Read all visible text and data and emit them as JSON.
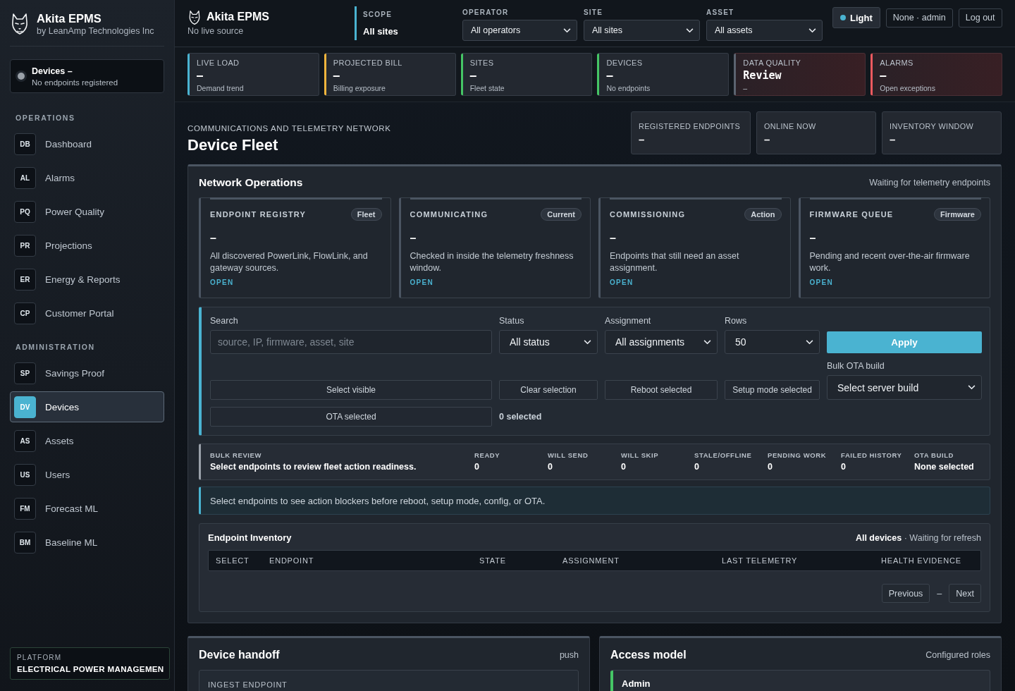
{
  "sidebar": {
    "brand": {
      "name": "Akita EPMS",
      "tagline": "by LeanAmp Technologies Inc"
    },
    "status": {
      "title": "Devices –",
      "detail": "No endpoints registered",
      "online": false
    },
    "sections": [
      {
        "title": "OPERATIONS",
        "items": [
          {
            "code": "DB",
            "label": "Dashboard",
            "selected": false
          },
          {
            "code": "AL",
            "label": "Alarms",
            "selected": false
          },
          {
            "code": "PQ",
            "label": "Power Quality",
            "selected": false
          },
          {
            "code": "PR",
            "label": "Projections",
            "selected": false
          },
          {
            "code": "ER",
            "label": "Energy & Reports",
            "selected": false
          },
          {
            "code": "CP",
            "label": "Customer Portal",
            "selected": false
          }
        ]
      },
      {
        "title": "ADMINISTRATION",
        "items": [
          {
            "code": "SP",
            "label": "Savings Proof",
            "selected": false
          },
          {
            "code": "DV",
            "label": "Devices",
            "selected": true
          },
          {
            "code": "AS",
            "label": "Assets",
            "selected": false
          },
          {
            "code": "US",
            "label": "Users",
            "selected": false
          },
          {
            "code": "FM",
            "label": "Forecast ML",
            "selected": false
          },
          {
            "code": "BM",
            "label": "Baseline ML",
            "selected": false
          }
        ]
      }
    ],
    "platform": {
      "label": "PLATFORM",
      "value": "ELECTRICAL POWER MANAGEMEN"
    }
  },
  "header": {
    "brand": "Akita EPMS",
    "source": "No live source",
    "scope": {
      "label": "SCOPE",
      "value": "All sites"
    },
    "filters": [
      {
        "label": "OPERATOR",
        "value": "All operators"
      },
      {
        "label": "SITE",
        "value": "All sites"
      },
      {
        "label": "ASSET",
        "value": "All assets"
      }
    ],
    "theme_button": "Light",
    "user_button": "None · admin",
    "logout_button": "Log out"
  },
  "kpis": [
    {
      "label": "LIVE LOAD",
      "value": "–",
      "caption": "Demand trend",
      "color": "#4ab3d1",
      "alert": false
    },
    {
      "label": "PROJECTED BILL",
      "value": "–",
      "caption": "Billing exposure",
      "color": "#f0b43c",
      "alert": false
    },
    {
      "label": "SITES",
      "value": "–",
      "caption": "Fleet state",
      "color": "#45c565",
      "alert": false
    },
    {
      "label": "DEVICES",
      "value": "–",
      "caption": "No endpoints",
      "color": "#45c565",
      "alert": false
    },
    {
      "label": "DATA QUALITY",
      "value": "Review",
      "caption": "–",
      "color": "#5b6470",
      "alert": true
    },
    {
      "label": "ALARMS",
      "value": "–",
      "caption": "Open exceptions",
      "color": "#ef5a5f",
      "alert": true
    }
  ],
  "page": {
    "kicker": "COMMUNICATIONS AND TELEMETRY NETWORK",
    "title": "Device Fleet",
    "stats": [
      {
        "label": "REGISTERED ENDPOINTS",
        "value": "–"
      },
      {
        "label": "ONLINE NOW",
        "value": "–"
      },
      {
        "label": "INVENTORY WINDOW",
        "value": "–"
      }
    ]
  },
  "network_operations": {
    "title": "Network Operations",
    "status": "Waiting for telemetry endpoints",
    "cards": [
      {
        "title": "ENDPOINT REGISTRY",
        "tag": "Fleet",
        "value": "–",
        "description": "All discovered PowerLink, FlowLink, and gateway sources.",
        "link": "OPEN"
      },
      {
        "title": "COMMUNICATING",
        "tag": "Current",
        "value": "–",
        "description": "Checked in inside the telemetry freshness window.",
        "link": "OPEN"
      },
      {
        "title": "COMMISSIONING",
        "tag": "Action",
        "value": "–",
        "description": "Endpoints that still need an asset assignment.",
        "link": "OPEN"
      },
      {
        "title": "FIRMWARE QUEUE",
        "tag": "Firmware",
        "value": "–",
        "description": "Pending and recent over-the-air firmware work.",
        "link": "OPEN"
      }
    ],
    "filters": {
      "search": {
        "label": "Search",
        "placeholder": "source, IP, firmware, asset, site"
      },
      "selects": [
        {
          "label": "Status",
          "value": "All status"
        },
        {
          "label": "Assignment",
          "value": "All assignments"
        },
        {
          "label": "Rows",
          "value": "50"
        }
      ],
      "apply_button": "Apply",
      "bulk_ota": {
        "label": "Bulk OTA build",
        "value": "Select server build"
      },
      "actions": [
        "Select visible",
        "Clear selection",
        "Reboot selected",
        "Setup mode selected"
      ],
      "ota_button": "OTA selected",
      "selection_count": "0 selected"
    },
    "bulk_review": {
      "label": "BULK REVIEW",
      "message": "Select endpoints to review fleet action readiness.",
      "metrics": [
        {
          "label": "READY",
          "value": "0"
        },
        {
          "label": "WILL SEND",
          "value": "0"
        },
        {
          "label": "WILL SKIP",
          "value": "0"
        },
        {
          "label": "STALE/OFFLINE",
          "value": "0"
        },
        {
          "label": "PENDING WORK",
          "value": "0"
        },
        {
          "label": "FAILED HISTORY",
          "value": "0"
        },
        {
          "label": "OTA BUILD",
          "value": "None selected"
        }
      ]
    },
    "notice": "Select endpoints to see action blockers before reboot, setup mode, config, or OTA.",
    "inventory": {
      "title": "Endpoint Inventory",
      "scope": "**All devices** · Waiting for refresh",
      "columns": [
        "SELECT",
        "ENDPOINT",
        "STATE",
        "ASSIGNMENT",
        "LAST TELEMETRY",
        "HEALTH EVIDENCE"
      ],
      "pagination": {
        "previous": "Previous",
        "page": "–",
        "next": "Next"
      }
    }
  },
  "device_handoff": {
    "title": "Device handoff",
    "mode": "push",
    "fields": [
      {
        "label": "INGEST ENDPOINT"
      }
    ]
  },
  "access_model": {
    "title": "Access model",
    "status": "Configured roles",
    "roles": [
      {
        "name": "Admin",
        "color": "#45c565"
      }
    ]
  }
}
